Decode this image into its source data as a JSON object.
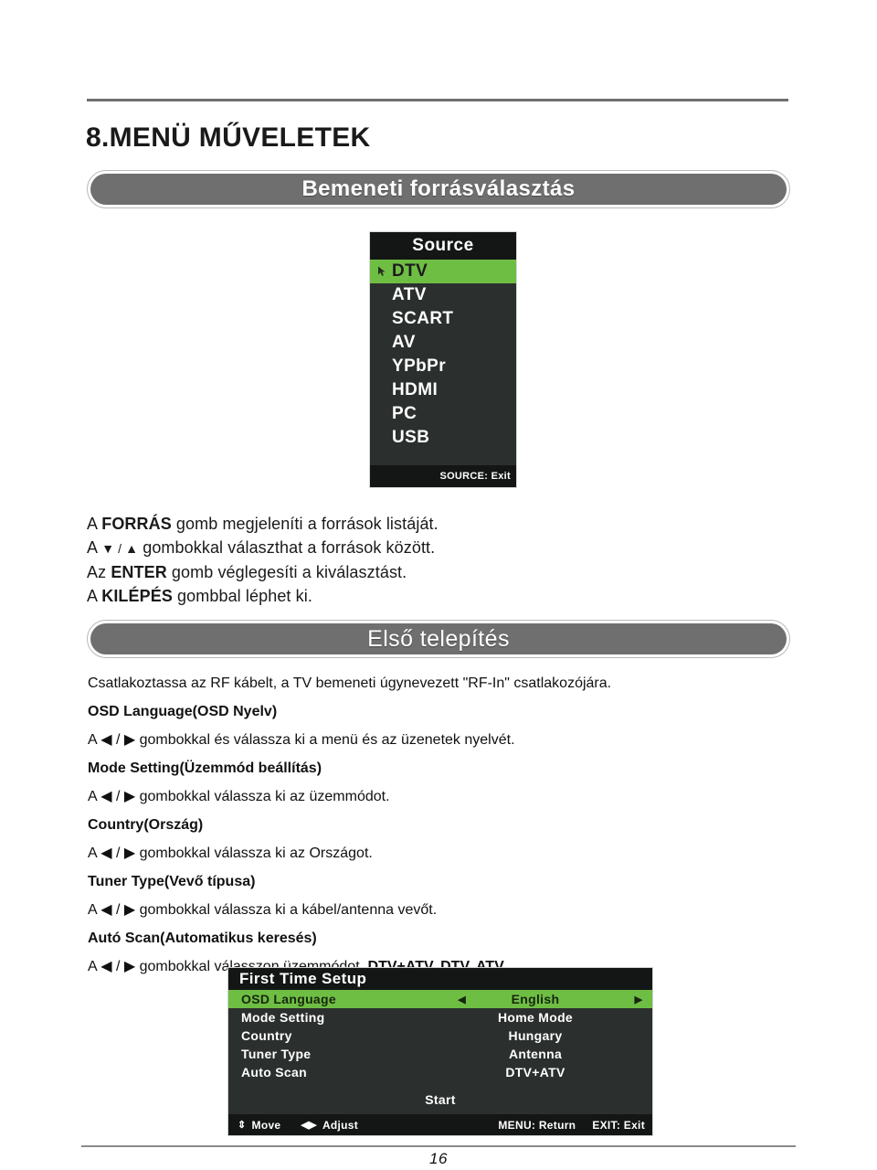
{
  "document": {
    "page_number": "16",
    "section_heading": "8.MENÜ MŰVELETEK"
  },
  "banners": {
    "source": "Bemeneti forrásválasztás",
    "first_time": "Első telepítés"
  },
  "source_osd": {
    "title": "Source",
    "cursor_icon": "pointer-icon",
    "items": [
      {
        "label": "DTV",
        "selected": true
      },
      {
        "label": "ATV",
        "selected": false
      },
      {
        "label": "SCART",
        "selected": false
      },
      {
        "label": "AV",
        "selected": false
      },
      {
        "label": "YPbPr",
        "selected": false
      },
      {
        "label": "HDMI",
        "selected": false
      },
      {
        "label": "PC",
        "selected": false
      },
      {
        "label": "USB",
        "selected": false
      }
    ],
    "footer": "SOURCE: Exit",
    "colors": {
      "background": "#2b2f2e",
      "title_bar": "#141615",
      "highlight": "#6fbe44",
      "text": "#ffffff"
    }
  },
  "source_instructions": [
    {
      "prefix": "A ",
      "bold": "FORRÁS",
      "suffix": " gomb megjeleníti a források listáját.",
      "glyph": ""
    },
    {
      "prefix": "A ",
      "bold": "",
      "glyph": "▼ / ▲",
      "suffix": " gombokkal választhat a források között."
    },
    {
      "prefix": "Az ",
      "bold": "ENTER",
      "suffix": " gomb véglegesíti a kiválasztást.",
      "glyph": ""
    },
    {
      "prefix": "A ",
      "bold": "KILÉPÉS",
      "suffix": " gombbal léphet ki.",
      "glyph": ""
    }
  ],
  "first_time_prose": [
    {
      "type": "body",
      "text": "Csatlakoztassa az RF kábelt, a TV bemeneti úgynevezett \"RF-In\" csatlakozójára."
    },
    {
      "type": "heading",
      "text": "OSD Language(OSD Nyelv)"
    },
    {
      "type": "body",
      "text": "A ◀ / ▶ gombokkal és válassza ki a menü és az üzenetek nyelvét."
    },
    {
      "type": "heading",
      "text": "Mode Setting(Üzemmód beállítás)"
    },
    {
      "type": "body",
      "text": "A ◀ / ▶ gombokkal válassza ki az üzemmódot."
    },
    {
      "type": "heading",
      "text": "Country(Ország)"
    },
    {
      "type": "body",
      "text": "A ◀ / ▶ gombokkal válassza ki az Országot."
    },
    {
      "type": "heading",
      "text": "Tuner Type(Vevő típusa)"
    },
    {
      "type": "body",
      "text": "A ◀ / ▶ gombokkal válassza ki a kábel/antenna vevőt."
    },
    {
      "type": "heading",
      "text": "Autó Scan(Automatikus keresés)"
    },
    {
      "type": "body_bold_tail",
      "text": "A ◀ / ▶ gombokkal válasszon üzemmódot. ",
      "bold_tail": "DTV+ATV, DTV, ATV."
    }
  ],
  "first_time_setup_osd": {
    "title": "First Time Setup",
    "rows": [
      {
        "label": "OSD Language",
        "value": "English",
        "selected": true,
        "left_arrow": "◀",
        "right_arrow": "▶"
      },
      {
        "label": "Mode Setting",
        "value": "Home Mode",
        "selected": false,
        "left_arrow": "",
        "right_arrow": ""
      },
      {
        "label": "Country",
        "value": "Hungary",
        "selected": false,
        "left_arrow": "",
        "right_arrow": ""
      },
      {
        "label": "Tuner Type",
        "value": "Antenna",
        "selected": false,
        "left_arrow": "",
        "right_arrow": ""
      },
      {
        "label": "Auto Scan",
        "value": "DTV+ATV",
        "selected": false,
        "left_arrow": "",
        "right_arrow": ""
      }
    ],
    "start_label": "Start",
    "footer": {
      "move_glyph": "⇕",
      "move_label": "Move",
      "adjust_glyph": "◀▶",
      "adjust_label": "Adjust",
      "menu_return": "MENU: Return",
      "exit_exit": "EXIT: Exit"
    },
    "colors": {
      "background": "#2b2f2e",
      "title_bar": "#141615",
      "highlight": "#6fbe44",
      "text": "#ffffff"
    }
  }
}
